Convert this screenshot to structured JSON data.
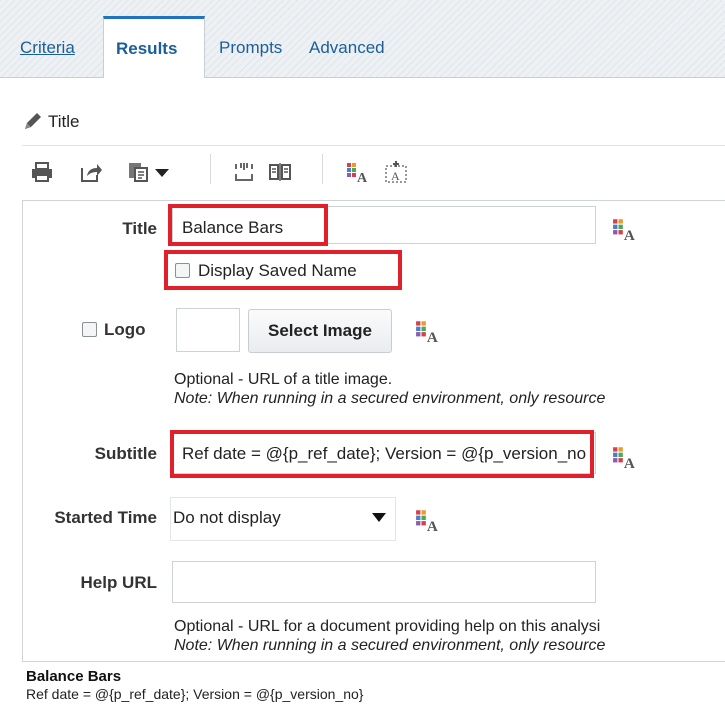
{
  "tabs": {
    "criteria": "Criteria",
    "results": "Results",
    "prompts": "Prompts",
    "advanced": "Advanced"
  },
  "view_title": "Title",
  "toolbar": {
    "icons": [
      "print-icon",
      "export-icon",
      "copy-view-icon",
      "dropdown-arrow-icon",
      "collapse-icon",
      "layout-icon",
      "format-text-icon",
      "insert-text-icon"
    ]
  },
  "form": {
    "title": {
      "label": "Title",
      "value": "Balance Bars",
      "display_saved_name_label": "Display Saved Name",
      "display_saved_name_checked": false
    },
    "logo": {
      "label": "Logo",
      "checked": false,
      "select_button": "Select Image",
      "help_line1": "Optional - URL of a title image.",
      "help_line2": "Note: When running in a secured environment, only resource"
    },
    "subtitle": {
      "label": "Subtitle",
      "value": "Ref date = @{p_ref_date}; Version = @{p_version_no}"
    },
    "started_time": {
      "label": "Started Time",
      "value": "Do not display"
    },
    "help_url": {
      "label": "Help URL",
      "value": "",
      "help_line1": "Optional - URL for a document providing help on this analysi",
      "help_line2": "Note: When running in a secured environment, only resource"
    }
  },
  "preview": {
    "title": "Balance Bars",
    "subtitle": "Ref date = @{p_ref_date}; Version = @{p_version_no}"
  },
  "colors": {
    "accent": "#1f73c2",
    "highlight": "#e0212b",
    "link": "#1a5e9a"
  }
}
